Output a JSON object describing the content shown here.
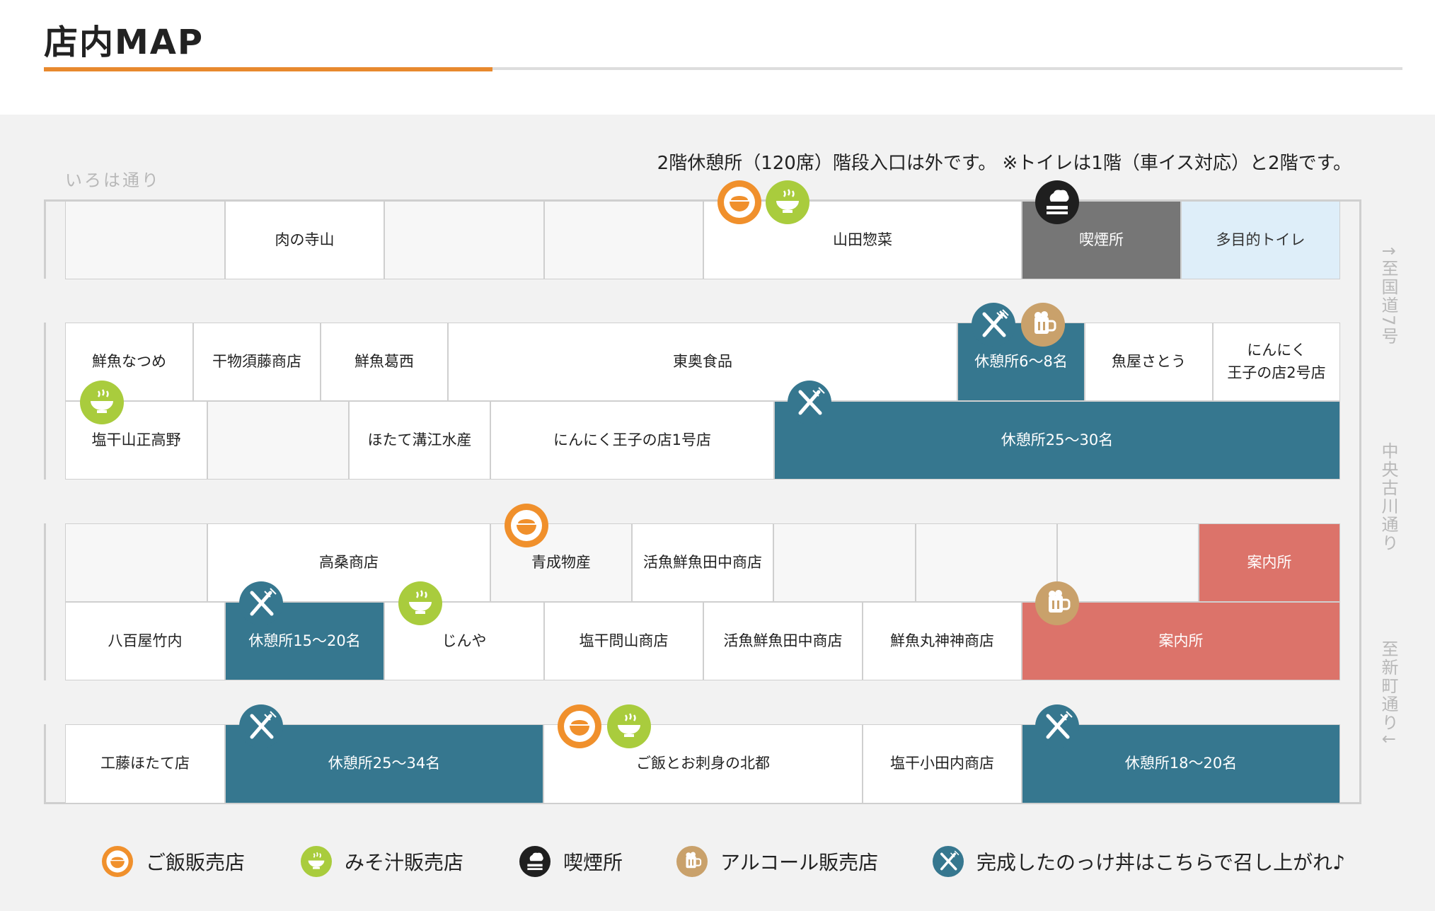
{
  "page": {
    "title": "店内MAP"
  },
  "notice": "2階休憩所（120席）階段入口は外です。 ※トイレは1階（車イス対応）と2階です。",
  "streets": {
    "top": "いろは通り",
    "right_1": "↑至国道7号",
    "right_2": "中央古川通り",
    "right_3": "至新町通り↓"
  },
  "colors": {
    "accent_orange": "#e8892e",
    "rest_area": "#36778f",
    "smoking": "#767676",
    "toilet": "#deeef9",
    "info": "#dc736a",
    "icon_rice": "#f0902c",
    "icon_miso": "#a9cc3d",
    "icon_smoke": "#1f1f1f",
    "icon_alcohol": "#c9a16b"
  },
  "map": {
    "row1": {
      "stalls": [
        "",
        "肉の寺山",
        "",
        "",
        "山田惣菜",
        "喫煙所",
        "多目的トイレ"
      ]
    },
    "row2": {
      "top": [
        "鮮魚なつめ",
        "干物須藤商店",
        "鮮魚葛西",
        "東奥食品",
        "休憩所6〜8名",
        "魚屋さとう",
        "にんにく\n王子の店2号店"
      ],
      "bottom": [
        "塩干山正高野",
        "",
        "ほたて溝江水産",
        "にんにく王子の店1号店",
        "休憩所25〜30名"
      ]
    },
    "row3": {
      "top": [
        "",
        "高桑商店",
        "青成物産",
        "活魚鮮魚田中商店",
        "",
        "",
        "",
        "案内所"
      ],
      "bottom": [
        "八百屋竹内",
        "休憩所15〜20名",
        "じんや",
        "塩干問山商店",
        "活魚鮮魚田中商店",
        "鮮魚丸神神商店",
        "案内所"
      ]
    },
    "row4": {
      "stalls": [
        "工藤ほたて店",
        "休憩所25〜34名",
        "ご飯とお刺身の北都",
        "塩干小田内商店",
        "休憩所18〜20名"
      ]
    }
  },
  "legend": [
    {
      "icon": "rice-bowl-icon",
      "label": "ご飯販売店"
    },
    {
      "icon": "miso-soup-icon",
      "label": "みそ汁販売店"
    },
    {
      "icon": "smoking-icon",
      "label": "喫煙所"
    },
    {
      "icon": "beer-mug-icon",
      "label": "アルコール販売店"
    },
    {
      "icon": "fork-knife-icon",
      "label": "完成したのっけ丼はこちらで召し上がれ♪"
    }
  ]
}
